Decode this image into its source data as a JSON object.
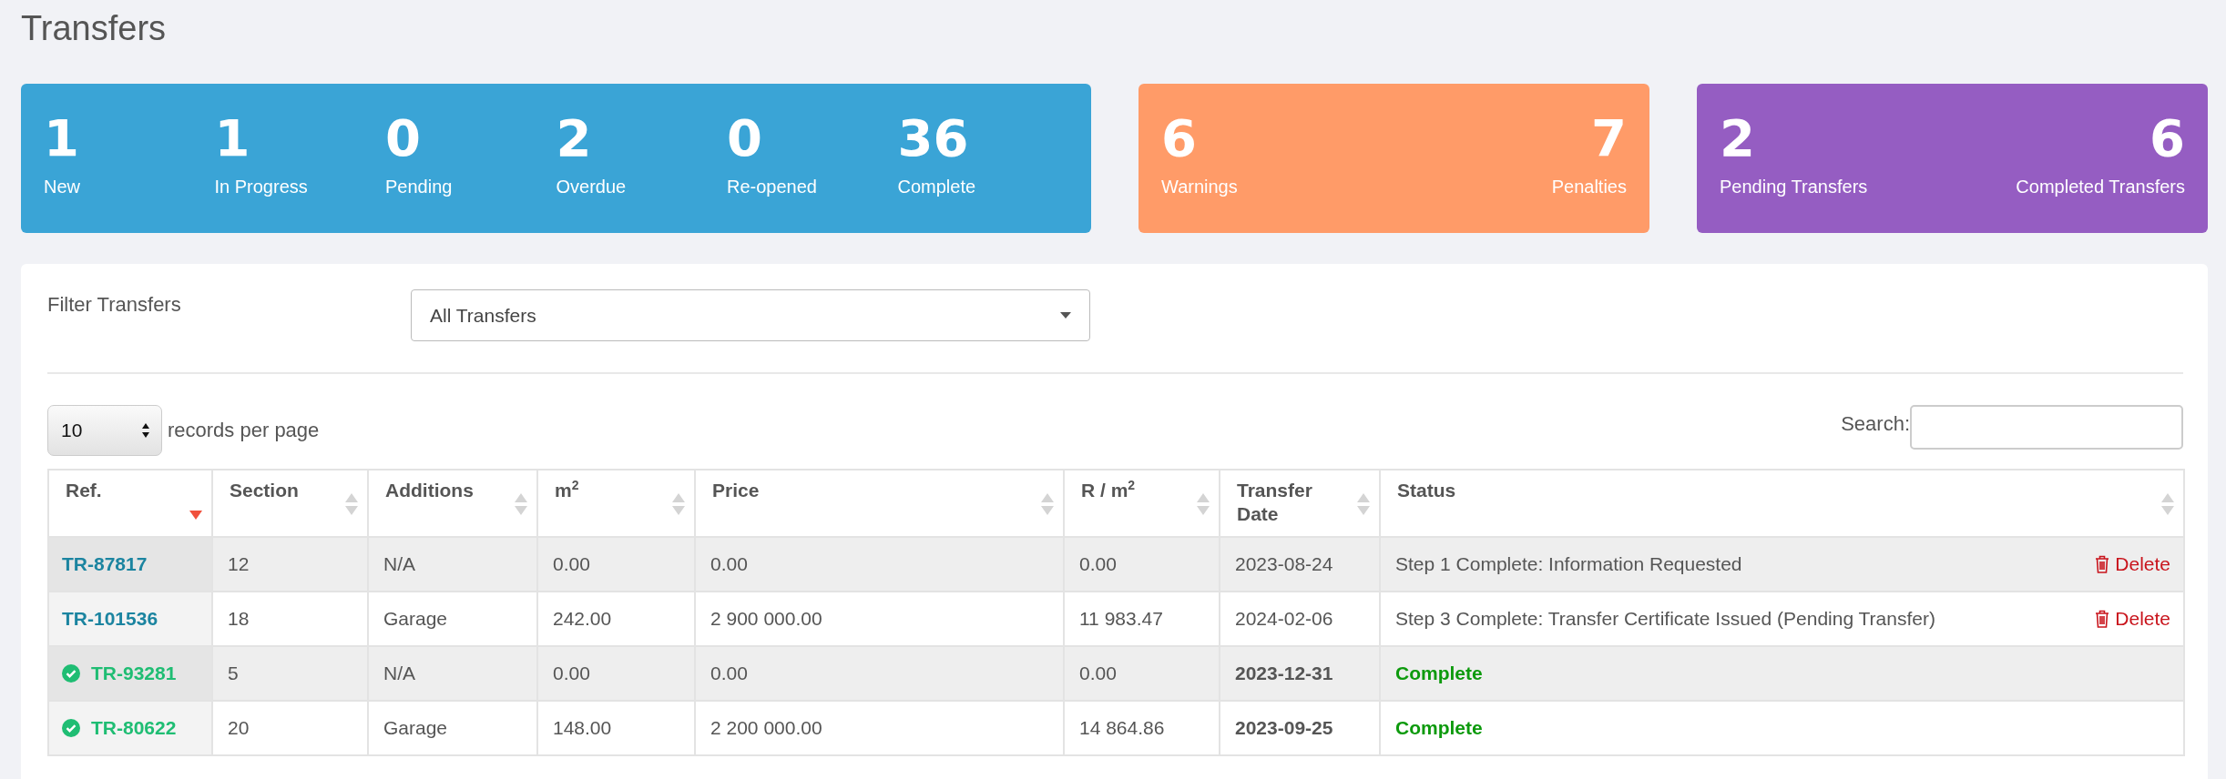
{
  "page_title": "Transfers",
  "summary_cards": [
    {
      "kind": "row",
      "color": "#3aa4d6",
      "stats": [
        {
          "value": "1",
          "label": "New"
        },
        {
          "value": "1",
          "label": "In Progress"
        },
        {
          "value": "0",
          "label": "Pending"
        },
        {
          "value": "2",
          "label": "Overdue"
        },
        {
          "value": "0",
          "label": "Re-opened"
        },
        {
          "value": "36",
          "label": "Complete"
        }
      ]
    },
    {
      "kind": "spread",
      "color": "#ff9b68",
      "stats": [
        {
          "value": "6",
          "label": "Warnings"
        },
        {
          "value": "7",
          "label": "Penalties"
        }
      ]
    },
    {
      "kind": "spread",
      "color": "#955dc2",
      "stats": [
        {
          "value": "2",
          "label": "Pending Transfers"
        },
        {
          "value": "6",
          "label": "Completed Transfers"
        }
      ]
    }
  ],
  "filter": {
    "label": "Filter Transfers",
    "value": "All Transfers"
  },
  "page_size": {
    "value": "10",
    "label": "records per page"
  },
  "search": {
    "label": "Search:"
  },
  "table": {
    "columns": [
      {
        "label": "Ref.",
        "sorted": true
      },
      {
        "label": "Section",
        "sorted": false
      },
      {
        "label": "Additions",
        "sorted": false
      },
      {
        "label": "m$^{2}$",
        "sorted": false
      },
      {
        "label": "Price",
        "sorted": false
      },
      {
        "label": "R / m$^{2}$",
        "sorted": false
      },
      {
        "label": "Transfer Date",
        "sorted": false
      },
      {
        "label": "Status",
        "sorted": false
      }
    ],
    "rows": [
      {
        "ref": "TR-87817",
        "completed": false,
        "section": "12",
        "additions": "N/A",
        "m2": "0.00",
        "price": "0.00",
        "r_per_m2": "0.00",
        "transfer_date": "2023-08-24",
        "status": "Step 1 Complete: Information Requested",
        "action": "Delete"
      },
      {
        "ref": "TR-101536",
        "completed": false,
        "section": "18",
        "additions": "Garage",
        "m2": "242.00",
        "price": "2 900 000.00",
        "r_per_m2": "11 983.47",
        "transfer_date": "2024-02-06",
        "status": "Step 3 Complete: Transfer Certificate Issued (Pending Transfer)",
        "action": "Delete"
      },
      {
        "ref": "TR-93281",
        "completed": true,
        "section": "5",
        "additions": "N/A",
        "m2": "0.00",
        "price": "0.00",
        "r_per_m2": "0.00",
        "transfer_date": "2023-12-31",
        "status": "Complete"
      },
      {
        "ref": "TR-80622",
        "completed": true,
        "section": "20",
        "additions": "Garage",
        "m2": "148.00",
        "price": "2 200 000.00",
        "r_per_m2": "14 864.86",
        "transfer_date": "2023-09-25",
        "status": "Complete"
      }
    ]
  }
}
